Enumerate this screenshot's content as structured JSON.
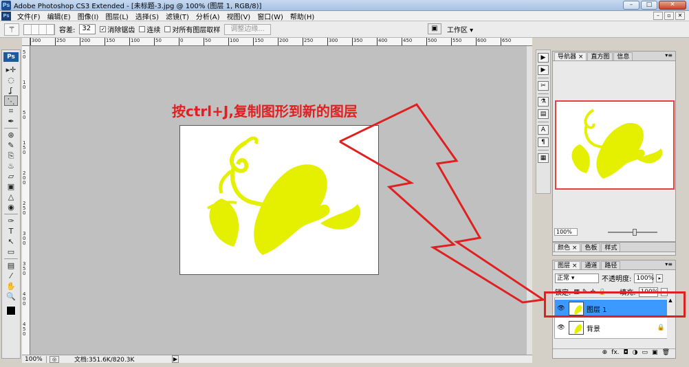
{
  "window": {
    "title": "Adobe Photoshop CS3 Extended - [未标题-3.jpg @ 100% (图层 1, RGB/8)]",
    "app_icon": "Ps",
    "buttons": [
      "–",
      "□",
      "✕"
    ]
  },
  "menubar": {
    "icon": "Ps",
    "items": [
      "文件(F)",
      "编辑(E)",
      "图像(I)",
      "图层(L)",
      "选择(S)",
      "滤镜(T)",
      "分析(A)",
      "视图(V)",
      "窗口(W)",
      "帮助(H)"
    ],
    "doc_buttons": [
      "–",
      "▫",
      "✕"
    ]
  },
  "options": {
    "tolerance_label": "容差:",
    "tolerance_value": "32",
    "antialias_label": "消除锯齿",
    "contiguous_label": "连续",
    "all_layers_label": "对所有图层取样",
    "refine_edge_label": "调整边缘...",
    "workspace_label": "工作区 ▾"
  },
  "toolbox": {
    "logo": "Ps",
    "tools": [
      "▸✛",
      "◌",
      "ʆ",
      "⋱",
      "⌗",
      "✒",
      "⊛",
      "✎",
      "⎘",
      "♨",
      "▱",
      "▣",
      "△",
      "◉",
      "✑",
      "T",
      "↖",
      "▭",
      "▤",
      "⁄",
      "✋",
      "🔍"
    ]
  },
  "rulers": {
    "h_ticks": [
      "300",
      "250",
      "200",
      "150",
      "100",
      "50",
      "0",
      "50",
      "100",
      "150",
      "200",
      "250",
      "300",
      "350",
      "400",
      "450",
      "500",
      "550",
      "600",
      "650"
    ],
    "v_ticks": [
      "5 0",
      "1 0",
      "5 0",
      "1 5 0",
      "2 0 0",
      "2 5 0",
      "3 0 0",
      "3 5 0",
      "4 0 0",
      "4 5 0"
    ]
  },
  "status": {
    "zoom": "100%",
    "doc_size": "文档:351.6K/820.3K"
  },
  "annotation": {
    "text": "按ctrl+J,复制图形到新的图层"
  },
  "dock_icons": [
    "▶",
    "▶",
    "✂",
    "⚗",
    "▤",
    "A",
    "¶",
    "▦"
  ],
  "navigator": {
    "tabs": [
      "导航器 ×",
      "直方图",
      "信息"
    ],
    "zoom": "100%"
  },
  "color_panel": {
    "tabs": [
      "颜色 ×",
      "色板",
      "样式"
    ]
  },
  "layers": {
    "tabs": [
      "图层 ×",
      "通道",
      "路径"
    ],
    "blend_mode": "正常",
    "opacity_label": "不透明度:",
    "opacity_value": "100%",
    "lock_label": "锁定:",
    "fill_label": "填充:",
    "fill_value": "100%",
    "rows": [
      {
        "name": "图层 1",
        "selected": true
      },
      {
        "name": "背景",
        "selected": false
      }
    ],
    "footer_icons": [
      "⊕",
      "fx.",
      "◘",
      "◑",
      "▭",
      "▣",
      "🗑"
    ]
  },
  "colors": {
    "annotation_red": "#e02020",
    "artwork_yellow": "#e4f000",
    "layer_selected": "#3c99ff",
    "canvas_gray": "#c0c0c0"
  }
}
